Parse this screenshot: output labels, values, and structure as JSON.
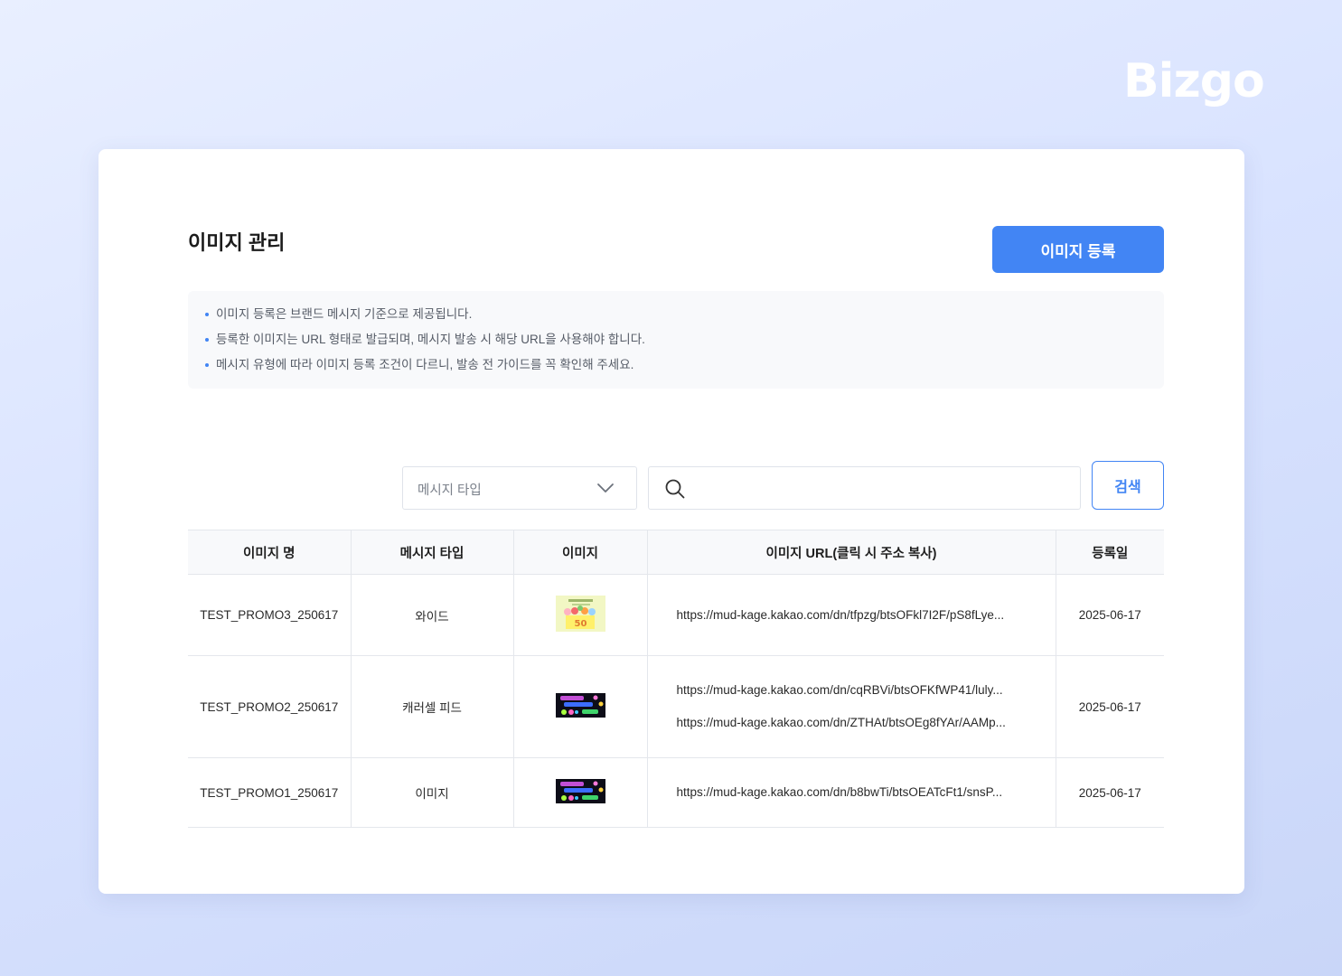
{
  "brand": {
    "logo_text": "Bizgo"
  },
  "page": {
    "title": "이미지 관리",
    "register_button_label": "이미지 등록"
  },
  "notices": [
    "이미지 등록은 브랜드 메시지 기준으로 제공됩니다.",
    "등록한 이미지는 URL 형태로 발급되며, 메시지 발송 시 해당 URL을 사용해야 합니다.",
    "메시지 유형에 따라 이미지 등록 조건이 다르니, 발송 전 가이드를 꼭 확인해 주세요."
  ],
  "filters": {
    "type_select_placeholder": "메시지 타입",
    "search_value": "",
    "search_button_label": "검색"
  },
  "table": {
    "headers": [
      "이미지 명",
      "메시지 타입",
      "이미지",
      "이미지 URL(클릭 시 주소 복사)",
      "등록일"
    ],
    "rows": [
      {
        "name": "TEST_PROMO3_250617",
        "type": "와이드",
        "thumbnail": "promo-50-thumbnail",
        "urls": [
          "https://mud-kage.kakao.com/dn/tfpzg/btsOFkl7I2F/pS8fLye..."
        ],
        "date": "2025-06-17"
      },
      {
        "name": "TEST_PROMO2_250617",
        "type": "캐러셀 피드",
        "thumbnail": "branding-agency-thumbnail",
        "urls": [
          "https://mud-kage.kakao.com/dn/cqRBVi/btsOFKfWP41/luly...",
          "https://mud-kage.kakao.com/dn/ZTHAt/btsOEg8fYAr/AAMp..."
        ],
        "date": "2025-06-17"
      },
      {
        "name": "TEST_PROMO1_250617",
        "type": "이미지",
        "thumbnail": "branding-agency-thumbnail",
        "urls": [
          "https://mud-kage.kakao.com/dn/b8bwTi/btsOEATcFt1/snsP..."
        ],
        "date": "2025-06-17"
      }
    ]
  },
  "colors": {
    "accent": "#4285f4",
    "background_gradient": [
      "#e9efff",
      "#c9d6f8"
    ]
  },
  "icons": {
    "select_chevron": "chevron-down-icon",
    "search": "search-icon"
  }
}
